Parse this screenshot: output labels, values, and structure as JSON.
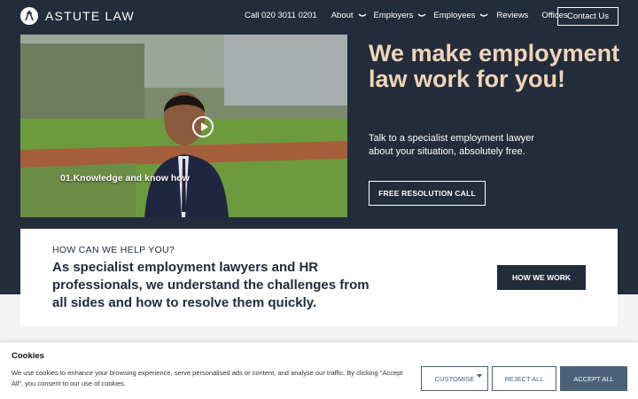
{
  "brand": {
    "name": "ASTUTE LAW"
  },
  "nav": {
    "phone": "Call 020 3011 0201",
    "items": [
      {
        "label": "About",
        "dropdown": true
      },
      {
        "label": "Employers",
        "dropdown": true
      },
      {
        "label": "Employees",
        "dropdown": true
      },
      {
        "label": "Reviews",
        "dropdown": false
      },
      {
        "label": "Offices",
        "dropdown": false
      }
    ],
    "contact_label": "Contact Us"
  },
  "hero": {
    "video_caption": "01.Knowledge and know how",
    "headline": "We make employment law work for you!",
    "subtext": "Talk to a specialist employment lawyer about your situation, absolutely free.",
    "cta_label": "FREE RESOLUTION CALL"
  },
  "help": {
    "eyebrow": "HOW CAN WE HELP YOU?",
    "text": "As specialist employment lawyers and HR professionals, we understand the challenges from all sides and how to resolve them quickly.",
    "button_label": "HOW WE WORK"
  },
  "cookie": {
    "title": "Cookies",
    "text": "We use cookies to enhance your browsing experience, serve personalised ads or content, and analyse our traffic. By clicking \"Accept All\", you consent to our use of cookies.",
    "customise_label": "CUSTOMISE",
    "reject_label": "REJECT ALL",
    "accept_label": "ACCEPT ALL"
  },
  "colors": {
    "navy": "#232c3b",
    "accent": "#f0d5b8",
    "cookie_button": "#4a6179"
  },
  "icons": [
    "logo-mark-icon",
    "chevron-down-icon",
    "play-icon",
    "caret-down-icon"
  ]
}
